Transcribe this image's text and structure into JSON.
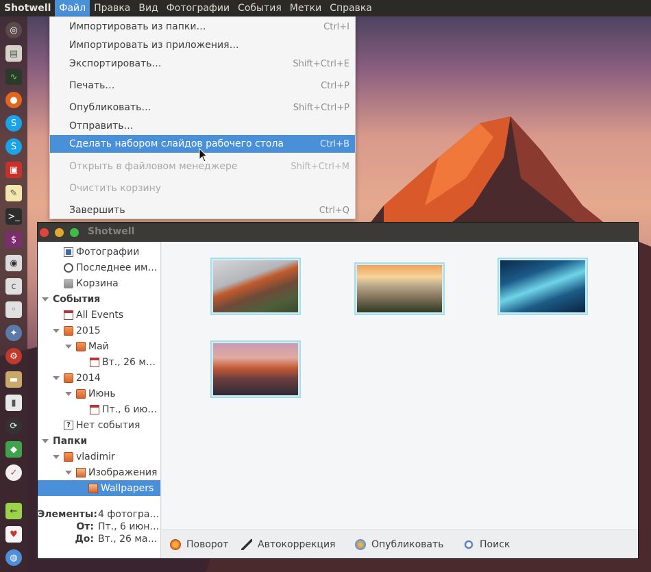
{
  "top_panel": {
    "app_name": "Shotwell",
    "menus": [
      "Файл",
      "Правка",
      "Вид",
      "Фотографии",
      "События",
      "Метки",
      "Справка"
    ],
    "active_menu": "Файл"
  },
  "file_menu": {
    "items": [
      {
        "label": "Импортировать из папки…",
        "accel": "Ctrl+I",
        "state": "normal"
      },
      {
        "label": "Импортировать из приложения…",
        "accel": "",
        "state": "normal"
      },
      {
        "label": "Экспортировать…",
        "accel": "Shift+Ctrl+E",
        "state": "normal"
      },
      {
        "label": "Печать…",
        "accel": "Ctrl+P",
        "state": "normal"
      },
      {
        "label": "Опубликовать…",
        "accel": "Shift+Ctrl+P",
        "state": "normal"
      },
      {
        "label": "Отправить…",
        "accel": "",
        "state": "normal"
      },
      {
        "label": "Сделать набором слайдов рабочего стола",
        "accel": "Ctrl+B",
        "state": "highlighted"
      },
      {
        "label": "Открыть в файловом менеджере",
        "accel": "Shift+Ctrl+M",
        "state": "disabled"
      },
      {
        "label": "Очистить корзину",
        "accel": "",
        "state": "disabled"
      },
      {
        "label": "Завершить",
        "accel": "Ctrl+Q",
        "state": "normal"
      }
    ]
  },
  "window": {
    "title": "Shotwell"
  },
  "sidebar": {
    "library": [
      "Фотографии",
      "Последнее им…",
      "Корзина"
    ],
    "events_header": "События",
    "events": {
      "all": "All Events",
      "year_2015": "2015",
      "month_may": "Май",
      "day_may": "Вт., 26 ма…",
      "year_2014": "2014",
      "month_june": "Июнь",
      "day_june": "Пт., 6 июн…",
      "no_event": "Нет события"
    },
    "folders_header": "Папки",
    "folders": {
      "user": "vladimir",
      "images": "Изображения",
      "wallpapers": "Wallpapers"
    },
    "info": {
      "elements_label": "Элементы:",
      "elements_value": "4 фотогра…",
      "from_label": "От:",
      "from_value": "Пт., 6 июн…",
      "to_label": "До:",
      "to_value": "Вт., 26 ма…"
    }
  },
  "toolbar": {
    "rotate": "Поворот",
    "autocorrect": "Автокоррекция",
    "publish": "Опубликовать",
    "search": "Поиск"
  },
  "colors": {
    "accent": "#4a90d9",
    "panel": "#2b2a27",
    "thumb_border": "#a7dce9"
  }
}
